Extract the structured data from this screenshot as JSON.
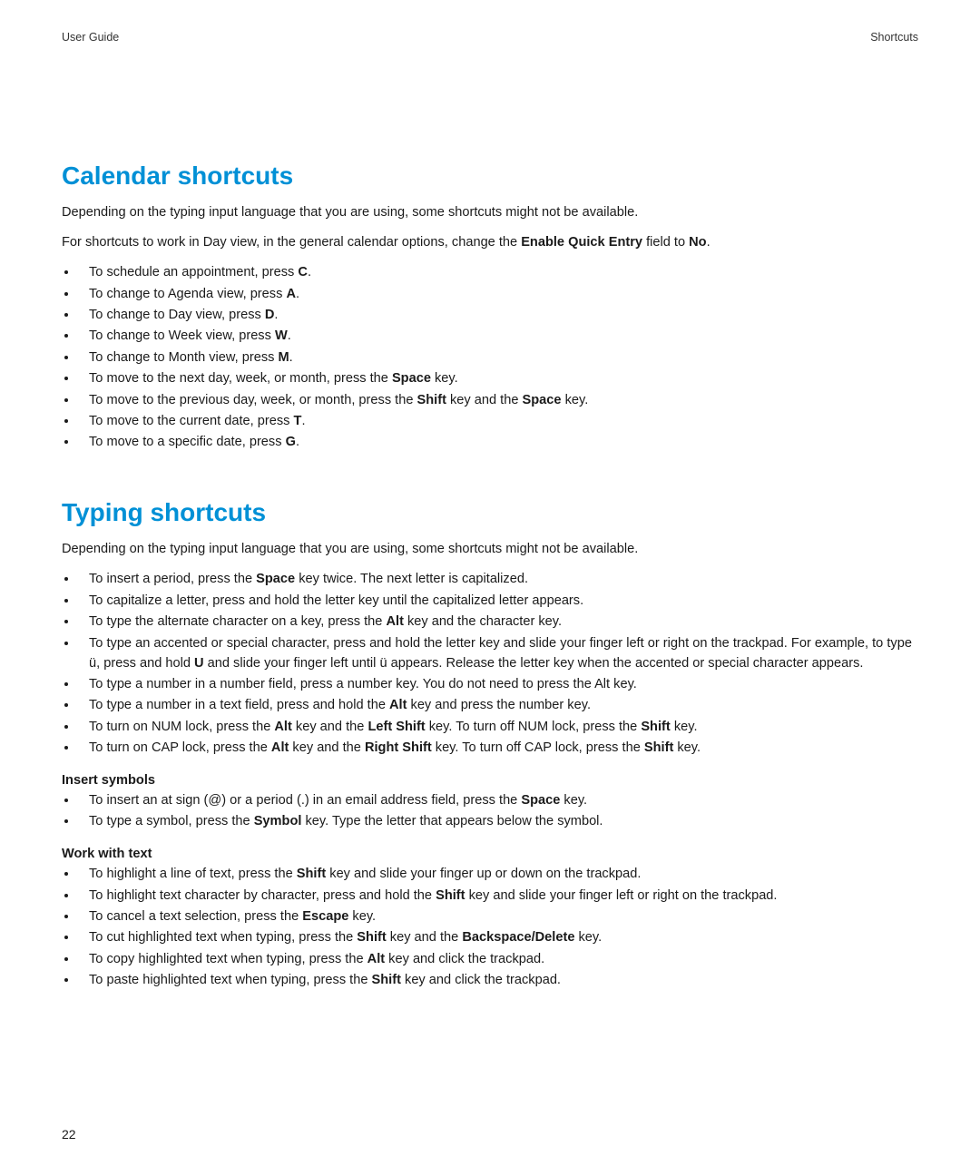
{
  "header": {
    "left": "User Guide",
    "right": "Shortcuts"
  },
  "page_number": "22",
  "calendar": {
    "title": "Calendar shortcuts",
    "intro1": "Depending on the typing input language that you are using, some shortcuts might not be available.",
    "intro2_a": "For shortcuts to work in Day view, in the general calendar options, change the ",
    "intro2_b": "Enable Quick Entry",
    "intro2_c": " field to ",
    "intro2_d": "No",
    "intro2_e": ".",
    "items": {
      "i0a": "To schedule an appointment, press ",
      "i0b": "C",
      "i0c": ".",
      "i1a": "To change to Agenda view, press ",
      "i1b": "A",
      "i1c": ".",
      "i2a": "To change to Day view, press ",
      "i2b": "D",
      "i2c": ".",
      "i3a": "To change to Week view, press ",
      "i3b": "W",
      "i3c": ".",
      "i4a": "To change to Month view, press ",
      "i4b": "M",
      "i4c": ".",
      "i5a": "To move to the next day, week, or month, press the ",
      "i5b": "Space",
      "i5c": " key.",
      "i6a": "To move to the previous day, week, or month, press the ",
      "i6b": "Shift",
      "i6c": " key and the ",
      "i6d": "Space",
      "i6e": " key.",
      "i7a": "To move to the current date, press ",
      "i7b": "T",
      "i7c": ".",
      "i8a": "To move to a specific date, press ",
      "i8b": "G",
      "i8c": "."
    }
  },
  "typing": {
    "title": "Typing shortcuts",
    "intro": "Depending on the typing input language that you are using, some shortcuts might not be available.",
    "items": {
      "t0a": "To insert a period, press the ",
      "t0b": "Space",
      "t0c": " key twice. The next letter is capitalized.",
      "t1": "To capitalize a letter, press and hold the letter key until the capitalized letter appears.",
      "t2a": "To type the alternate character on a key, press the ",
      "t2b": "Alt",
      "t2c": " key and the character key.",
      "t3a": "To type an accented or special character, press and hold the letter key and slide your finger left or right on the trackpad. For example, to type ü, press and hold ",
      "t3b": "U",
      "t3c": " and slide your finger left until ü appears. Release the letter key when the accented or special character appears.",
      "t4": "To type a number in a number field, press a number key. You do not need to press the Alt key.",
      "t5a": "To type a number in a text field, press and hold the ",
      "t5b": "Alt",
      "t5c": " key and press the number key.",
      "t6a": "To turn on NUM lock, press the ",
      "t6b": "Alt",
      "t6c": " key and the ",
      "t6d": "Left Shift",
      "t6e": " key. To turn off NUM lock, press the ",
      "t6f": "Shift",
      "t6g": " key.",
      "t7a": "To turn on CAP lock, press the ",
      "t7b": "Alt",
      "t7c": " key and the ",
      "t7d": "Right Shift",
      "t7e": " key. To turn off CAP lock, press the ",
      "t7f": "Shift",
      "t7g": " key."
    },
    "symbols_h": "Insert symbols",
    "symbols": {
      "s0a": "To insert an at sign (@) or a period (.) in an email address field, press the ",
      "s0b": "Space",
      "s0c": " key.",
      "s1a": "To type a symbol, press the ",
      "s1b": "Symbol",
      "s1c": " key. Type the letter that appears below the symbol."
    },
    "work_h": "Work with text",
    "work": {
      "w0a": "To highlight a line of text, press the ",
      "w0b": "Shift",
      "w0c": " key and slide your finger up or down on the trackpad.",
      "w1a": "To highlight text character by character, press and hold the ",
      "w1b": "Shift",
      "w1c": " key and slide your finger left or right on the trackpad.",
      "w2a": "To cancel a text selection, press the ",
      "w2b": "Escape",
      "w2c": " key.",
      "w3a": "To cut highlighted text when typing, press the ",
      "w3b": "Shift",
      "w3c": " key and the ",
      "w3d": "Backspace/Delete",
      "w3e": " key.",
      "w4a": "To copy highlighted text when typing, press the ",
      "w4b": "Alt",
      "w4c": " key and click the trackpad.",
      "w5a": "To paste highlighted text when typing, press the ",
      "w5b": "Shift",
      "w5c": " key and click the trackpad."
    }
  }
}
